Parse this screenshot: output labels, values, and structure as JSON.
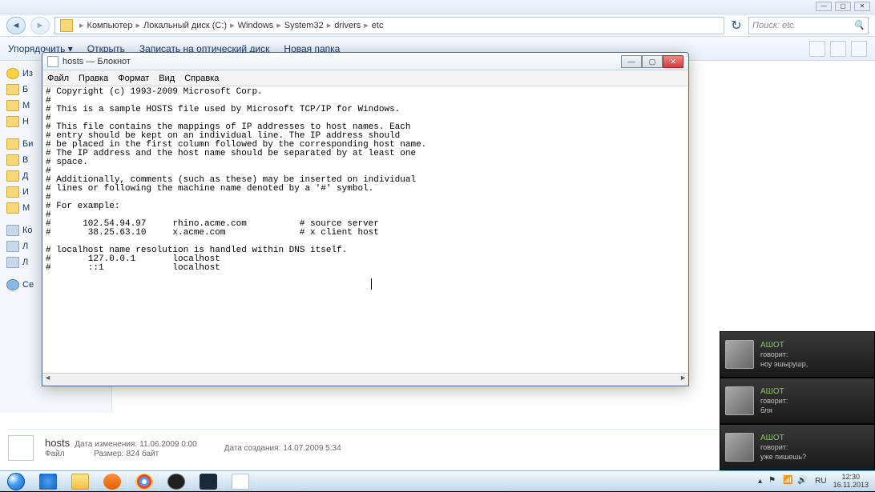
{
  "explorer": {
    "breadcrumb": [
      "Компьютер",
      "Локальный диск (C:)",
      "Windows",
      "System32",
      "drivers",
      "etc"
    ],
    "search_placeholder": "Поиск: etc",
    "toolbar": {
      "organize": "Упорядочить ▾",
      "open": "Открыть",
      "burn": "Записать на оптический диск",
      "new_folder": "Новая папка"
    },
    "sidebar": {
      "favorites": "Из",
      "items1": [
        "Б",
        "М",
        "Н"
      ],
      "libs": "Би",
      "items2": [
        "В",
        "Д",
        "И",
        "М"
      ],
      "computer": "Ко",
      "items3": [
        "Л",
        "Л"
      ],
      "network": "Се"
    },
    "status": {
      "name": "hosts",
      "mod_label": "Дата изменения:",
      "mod_val": "11.06.2009 0:00",
      "created_label": "Дата создания:",
      "created_val": "14.07.2009 5:34",
      "type": "Файл",
      "size_label": "Размер:",
      "size_val": "824 байт"
    }
  },
  "notepad": {
    "title": "hosts — Блокнот",
    "menu": [
      "Файл",
      "Правка",
      "Формат",
      "Вид",
      "Справка"
    ],
    "content": "# Copyright (c) 1993-2009 Microsoft Corp.\n#\n# This is a sample HOSTS file used by Microsoft TCP/IP for Windows.\n#\n# This file contains the mappings of IP addresses to host names. Each\n# entry should be kept on an individual line. The IP address should\n# be placed in the first column followed by the corresponding host name.\n# The IP address and the host name should be separated by at least one\n# space.\n#\n# Additionally, comments (such as these) may be inserted on individual\n# lines or following the machine name denoted by a '#' symbol.\n#\n# For example:\n#\n#      102.54.94.97     rhino.acme.com          # source server\n#       38.25.63.10     x.acme.com              # x client host\n\n# localhost name resolution is handled within DNS itself.\n#       127.0.0.1       localhost\n#       ::1             localhost\n"
  },
  "notifications": [
    {
      "name": "АШОТ",
      "says": "говорит:",
      "msg": "ноу эшырушр,"
    },
    {
      "name": "АШОТ",
      "says": "говорит:",
      "msg": "бля"
    },
    {
      "name": "АШОТ",
      "says": "говорит:",
      "msg": "уже пишешь?"
    }
  ],
  "taskbar": {
    "lang": "RU",
    "time": "12:30",
    "date": "16.11.2013"
  }
}
